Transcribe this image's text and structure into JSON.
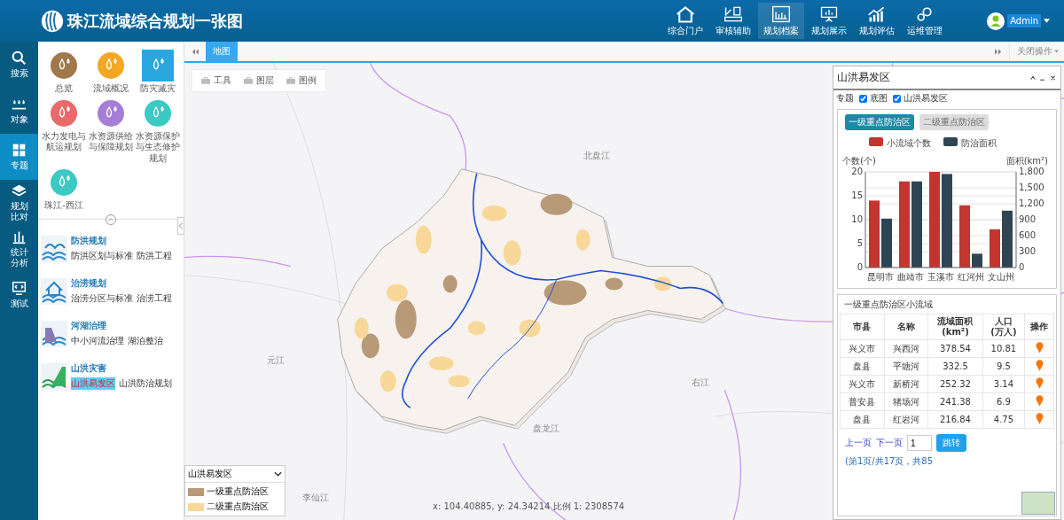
{
  "header": {
    "title": "珠江流域综合规划一张图",
    "nav": [
      {
        "label": "综合门户",
        "selected": false
      },
      {
        "label": "审核辅助",
        "selected": false
      },
      {
        "label": "规划档案",
        "selected": true
      },
      {
        "label": "规划展示",
        "selected": false
      },
      {
        "label": "规划评估",
        "selected": false
      },
      {
        "label": "运维管理",
        "selected": false
      }
    ],
    "user": "Admin"
  },
  "rail": [
    {
      "label": "搜索",
      "selected": false
    },
    {
      "label": "对象",
      "selected": false
    },
    {
      "label": "专题",
      "selected": true
    },
    {
      "label": "规划比对",
      "selected": false
    },
    {
      "label": "统计分析",
      "selected": false
    },
    {
      "label": "测试",
      "selected": false
    }
  ],
  "topics": [
    {
      "label": "总览",
      "color": "#a0784a",
      "selected": false
    },
    {
      "label": "流域概况",
      "color": "#f5a623",
      "selected": false
    },
    {
      "label": "防灾减灾",
      "color": "#29a8e0",
      "selected": true
    },
    {
      "label": "水力发电与航运规划",
      "color": "#e86a6a",
      "selected": false
    },
    {
      "label": "水资源供给与保障规划",
      "color": "#a57fd6",
      "selected": false
    },
    {
      "label": "水资源保护与生态修护规划",
      "color": "#3cc9c3",
      "selected": false
    },
    {
      "label": "珠江-西江",
      "color": "#3cc9c3",
      "selected": false
    }
  ],
  "subtopics": [
    {
      "title": "防洪规划",
      "links": [
        {
          "label": "防洪区划与标准",
          "selected": false
        },
        {
          "label": "防洪工程",
          "selected": false
        }
      ]
    },
    {
      "title": "治涝规划",
      "links": [
        {
          "label": "治涝分区与标准",
          "selected": false
        },
        {
          "label": "治涝工程",
          "selected": false
        }
      ]
    },
    {
      "title": "河湖治理",
      "links": [
        {
          "label": "中小河流治理",
          "selected": false
        },
        {
          "label": "湖泊整治",
          "selected": false
        }
      ]
    },
    {
      "title": "山洪灾害",
      "links": [
        {
          "label": "山洪易发区",
          "selected": true
        },
        {
          "label": "山洪防治规划",
          "selected": false
        }
      ]
    }
  ],
  "tabs": [
    {
      "label": "地图",
      "selected": true
    }
  ],
  "close_ops": "关闭操作",
  "toolbar": [
    "工具",
    "图层",
    "图例"
  ],
  "map_labels": [
    "北盘江",
    "元江",
    "右江",
    "盘龙江",
    "李仙江"
  ],
  "coordinates": "x: 104.40885, y: 24.34214 比例 1: 2308574",
  "legend": {
    "title": "山洪易发区",
    "items": [
      {
        "label": "一级重点防治区",
        "color": "#b89a78"
      },
      {
        "label": "二级重点防治区",
        "color": "#f8d898"
      }
    ]
  },
  "panel": {
    "title": "山洪易发区",
    "layer_label": "专题",
    "layers": [
      {
        "label": "底图",
        "checked": true
      },
      {
        "label": "山洪易发区",
        "checked": true
      }
    ],
    "levels": [
      {
        "label": "一级重点防治区",
        "selected": true
      },
      {
        "label": "二级重点防治区",
        "selected": false
      }
    ],
    "chart_data": {
      "type": "bar",
      "categories": [
        "昆明市",
        "曲靖市",
        "玉溪市",
        "红河州",
        "文山州"
      ],
      "series": [
        {
          "name": "小流域个数",
          "color": "#c23531",
          "values": [
            14,
            18,
            20,
            13,
            8
          ]
        },
        {
          "name": "防治面积",
          "color": "#2f4554",
          "values": [
            920,
            1620,
            1760,
            260,
            1070
          ],
          "axis": "y2"
        }
      ],
      "ylabel": "个数(个)",
      "ylim": [
        0,
        20
      ],
      "yticks": [
        0,
        5,
        10,
        15,
        20
      ],
      "y2label": "面积(km²)",
      "y2lim": [
        0,
        1800
      ],
      "y2ticks": [
        0,
        300,
        600,
        900,
        {
          "value": 1200,
          "label": "1,200"
        },
        {
          "value": 1500,
          "label": "1,500"
        },
        {
          "value": 1800,
          "label": "1,800"
        }
      ],
      "grid": true,
      "legend": "top"
    },
    "table_title": "一级重点防治区小流域",
    "columns": [
      "市县",
      "名称",
      "流域面积\n(km²)",
      "人口\n(万人)",
      "操作"
    ],
    "rows": [
      [
        "兴义市",
        "兴西河",
        "378.54",
        "10.81"
      ],
      [
        "盘县",
        "平塘河",
        "332.5",
        "9.5"
      ],
      [
        "兴义市",
        "新桥河",
        "252.32",
        "3.14"
      ],
      [
        "普安县",
        "猪场河",
        "241.38",
        "6.9"
      ],
      [
        "盘县",
        "红岩河",
        "216.84",
        "4.75"
      ]
    ],
    "prev": "上一页",
    "next": "下一页",
    "page_value": "1",
    "jump": "跳转",
    "page_info": "(第1页/共17页，共85"
  }
}
